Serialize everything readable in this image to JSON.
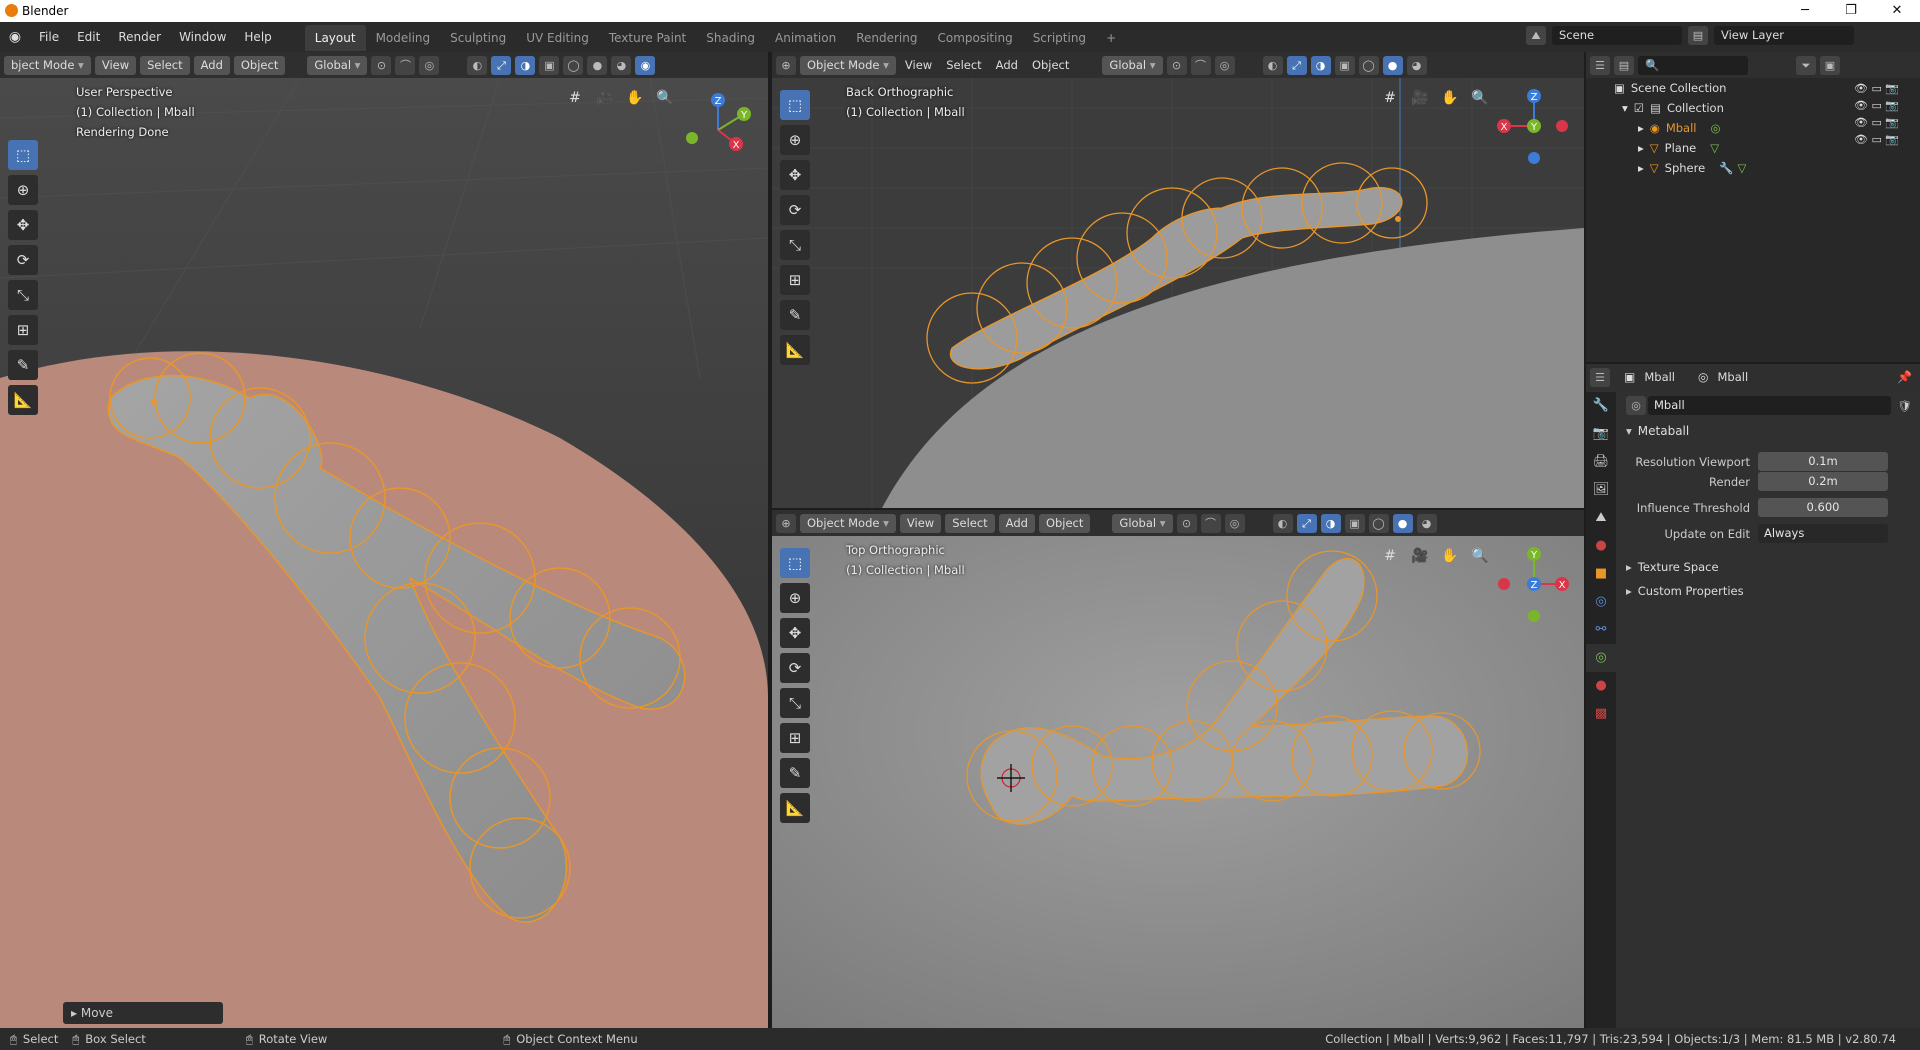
{
  "app": {
    "title": "Blender",
    "colors": {
      "accent": "#4772b3",
      "select": "#e8962a",
      "bg": "#1d1d1d",
      "panel": "#303030"
    }
  },
  "menu": [
    "File",
    "Edit",
    "Render",
    "Window",
    "Help"
  ],
  "workspaces": [
    {
      "label": "Layout",
      "active": true
    },
    {
      "label": "Modeling"
    },
    {
      "label": "Sculpting"
    },
    {
      "label": "UV Editing"
    },
    {
      "label": "Texture Paint"
    },
    {
      "label": "Shading"
    },
    {
      "label": "Animation"
    },
    {
      "label": "Rendering"
    },
    {
      "label": "Compositing"
    },
    {
      "label": "Scripting"
    }
  ],
  "add_workspace": "+",
  "scene": {
    "label": "Scene",
    "view_layer": "View Layer"
  },
  "vp_left": {
    "mode": "bject Mode",
    "view": "View",
    "select": "Select",
    "add": "Add",
    "object": "Object",
    "orientation": "Global",
    "overlay1": "User Perspective",
    "overlay2": "(1) Collection | Mball",
    "overlay3": "Rendering Done",
    "panel": "Move"
  },
  "vp_tr": {
    "mode": "Object Mode",
    "view": "View",
    "select": "Select",
    "add": "Add",
    "object": "Object",
    "orientation": "Global",
    "overlay1": "Back Orthographic",
    "overlay2": "(1) Collection | Mball"
  },
  "vp_br": {
    "mode": "Object Mode",
    "view": "View",
    "select": "Select",
    "add": "Add",
    "object": "Object",
    "orientation": "Global",
    "overlay1": "Top Orthographic",
    "overlay2": "(1) Collection | Mball"
  },
  "gizmo": {
    "x": "X",
    "y": "Y",
    "z": "Z"
  },
  "outliner": {
    "root": "Scene Collection",
    "collection": "Collection",
    "items": [
      {
        "name": "Mball",
        "selected": true
      },
      {
        "name": "Plane"
      },
      {
        "name": "Sphere"
      }
    ]
  },
  "properties": {
    "obj": "Mball",
    "data": "Mball",
    "datablock": "Mball",
    "section": "Metaball",
    "rows": [
      {
        "label": "Resolution Viewport",
        "value": "0.1m"
      },
      {
        "label": "Render",
        "value": "0.2m"
      },
      {
        "label": "Influence Threshold",
        "value": "0.600"
      },
      {
        "label": "Update on Edit",
        "value": "Always"
      }
    ],
    "sub1": "Texture Space",
    "sub2": "Custom Properties"
  },
  "status": {
    "select": "Select",
    "box": "Box Select",
    "rotate": "Rotate View",
    "ctx": "Object Context Menu",
    "info": "Collection | Mball | Verts:9,962 | Faces:11,797 | Tris:23,594 | Objects:1/3 | Mem: 81.5 MB | v2.80.74"
  }
}
